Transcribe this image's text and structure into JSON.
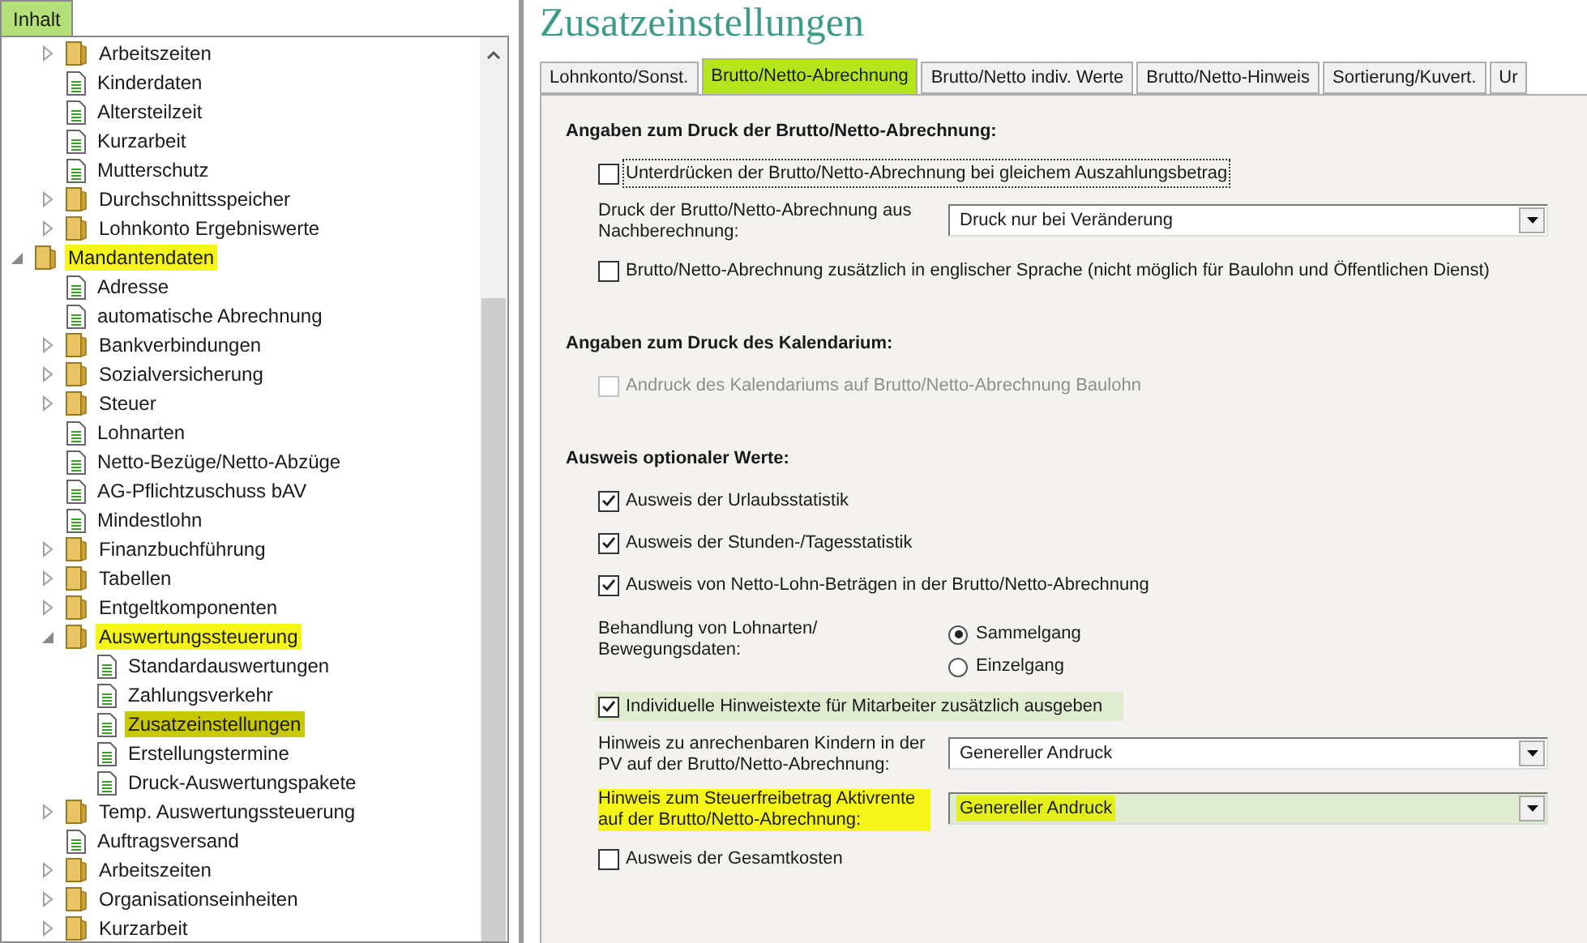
{
  "sidebar": {
    "tab": {
      "label": "Inhalt",
      "selected": true
    },
    "tree": {
      "continued_items": [
        {
          "label": "Arbeitszeiten",
          "kind": "folder",
          "expanded": false,
          "selected": false,
          "highlighted": false
        },
        {
          "label": "Kinderdaten",
          "kind": "page",
          "selected": false,
          "highlighted": false
        },
        {
          "label": "Altersteilzeit",
          "kind": "page",
          "selected": false,
          "highlighted": false
        },
        {
          "label": "Kurzarbeit",
          "kind": "page",
          "selected": false,
          "highlighted": false
        },
        {
          "label": "Mutterschutz",
          "kind": "page",
          "selected": false,
          "highlighted": false
        },
        {
          "label": "Durchschnittsspeicher",
          "kind": "folder",
          "expanded": false,
          "selected": false,
          "highlighted": false
        },
        {
          "label": "Lohnkonto Ergebniswerte",
          "kind": "folder",
          "expanded": false,
          "selected": false,
          "highlighted": false
        }
      ],
      "items": [
        {
          "label": "Mandantendaten",
          "kind": "folder",
          "expanded": true,
          "selected": false,
          "highlighted": true,
          "children": [
            {
              "label": "Adresse",
              "kind": "page",
              "selected": false,
              "highlighted": false
            },
            {
              "label": "automatische Abrechnung",
              "kind": "page",
              "selected": false,
              "highlighted": false
            },
            {
              "label": "Bankverbindungen",
              "kind": "folder",
              "expanded": false,
              "selected": false,
              "highlighted": false
            },
            {
              "label": "Sozialversicherung",
              "kind": "folder",
              "expanded": false,
              "selected": false,
              "highlighted": false
            },
            {
              "label": "Steuer",
              "kind": "folder",
              "expanded": false,
              "selected": false,
              "highlighted": false
            },
            {
              "label": "Lohnarten",
              "kind": "page",
              "selected": false,
              "highlighted": false
            },
            {
              "label": "Netto-Bezüge/Netto-Abzüge",
              "kind": "page",
              "selected": false,
              "highlighted": false
            },
            {
              "label": "AG-Pflichtzuschuss bAV",
              "kind": "page",
              "selected": false,
              "highlighted": false
            },
            {
              "label": "Mindestlohn",
              "kind": "page",
              "selected": false,
              "highlighted": false
            },
            {
              "label": "Finanzbuchführung",
              "kind": "folder",
              "expanded": false,
              "selected": false,
              "highlighted": false
            },
            {
              "label": "Tabellen",
              "kind": "folder",
              "expanded": false,
              "selected": false,
              "highlighted": false
            },
            {
              "label": "Entgeltkomponenten",
              "kind": "folder",
              "expanded": false,
              "selected": false,
              "highlighted": false
            },
            {
              "label": "Auswertungssteuerung",
              "kind": "folder",
              "expanded": true,
              "selected": false,
              "highlighted": true,
              "children": [
                {
                  "label": "Standardauswertungen",
                  "kind": "page",
                  "selected": false,
                  "highlighted": false
                },
                {
                  "label": "Zahlungsverkehr",
                  "kind": "page",
                  "selected": false,
                  "highlighted": false
                },
                {
                  "label": "Zusatzeinstellungen",
                  "kind": "page",
                  "selected": true,
                  "highlighted": true
                },
                {
                  "label": "Erstellungstermine",
                  "kind": "page",
                  "selected": false,
                  "highlighted": false
                },
                {
                  "label": "Druck-Auswertungspakete",
                  "kind": "page",
                  "selected": false,
                  "highlighted": false
                }
              ]
            },
            {
              "label": "Temp. Auswertungssteuerung",
              "kind": "folder",
              "expanded": false,
              "selected": false,
              "highlighted": false
            },
            {
              "label": "Auftragsversand",
              "kind": "page",
              "selected": false,
              "highlighted": false
            },
            {
              "label": "Arbeitszeiten",
              "kind": "folder",
              "expanded": false,
              "selected": false,
              "highlighted": false
            },
            {
              "label": "Organisationseinheiten",
              "kind": "folder",
              "expanded": false,
              "selected": false,
              "highlighted": false
            },
            {
              "label": "Kurzarbeit",
              "kind": "folder",
              "expanded": false,
              "selected": false,
              "highlighted": false
            }
          ]
        }
      ]
    }
  },
  "main": {
    "title": "Zusatzeinstellungen",
    "tabs": [
      {
        "label": "Lohnkonto/Sonst.",
        "selected": false,
        "highlighted": false
      },
      {
        "label": "Brutto/Netto-Abrechnung",
        "selected": true,
        "highlighted": true
      },
      {
        "label": "Brutto/Netto indiv. Werte",
        "selected": false,
        "highlighted": false
      },
      {
        "label": "Brutto/Netto-Hinweis",
        "selected": false,
        "highlighted": false
      },
      {
        "label": "Sortierung/Kuvert.",
        "selected": false,
        "highlighted": false
      },
      {
        "label": "Ur",
        "selected": false,
        "highlighted": false
      }
    ],
    "sections": [
      {
        "title": "Angaben zum Druck der Brutto/Netto-Abrechnung:",
        "rows": [
          {
            "kind": "checkbox",
            "label": "Unterdrücken der Brutto/Netto-Abrechnung bei gleichem Auszahlungsbetrag",
            "checked": false,
            "disabled": false,
            "focused": true,
            "highlighted": false
          },
          {
            "kind": "dropdown",
            "label": "Druck der Brutto/Netto-Abrechnung aus Nachberechnung:",
            "value": "Druck nur bei Veränderung",
            "highlighted": false
          },
          {
            "kind": "checkbox",
            "label": "Brutto/Netto-Abrechnung zusätzlich in englischer Sprache (nicht möglich für Baulohn und Öffentlichen Dienst)",
            "checked": false,
            "disabled": false,
            "focused": false,
            "highlighted": false
          }
        ]
      },
      {
        "title": "Angaben zum Druck des Kalendarium:",
        "rows": [
          {
            "kind": "checkbox",
            "label": "Andruck des Kalendariums auf Brutto/Netto-Abrechnung Baulohn",
            "checked": false,
            "disabled": true,
            "focused": false,
            "highlighted": false
          }
        ]
      },
      {
        "title": "Ausweis optionaler Werte:",
        "rows": [
          {
            "kind": "checkbox",
            "label": "Ausweis der Urlaubsstatistik",
            "checked": true,
            "disabled": false,
            "focused": false,
            "highlighted": false
          },
          {
            "kind": "checkbox",
            "label": "Ausweis der Stunden-/Tagesstatistik",
            "checked": true,
            "disabled": false,
            "focused": false,
            "highlighted": false
          },
          {
            "kind": "checkbox",
            "label": "Ausweis von Netto-Lohn-Beträgen in der Brutto/Netto-Abrechnung",
            "checked": true,
            "disabled": false,
            "focused": false,
            "highlighted": false
          },
          {
            "kind": "radio_group",
            "label": "Behandlung von Lohnarten/ Bewegungsdaten:",
            "options": [
              {
                "label": "Sammelgang",
                "selected": true
              },
              {
                "label": "Einzelgang",
                "selected": false
              }
            ]
          },
          {
            "kind": "checkbox",
            "label": "Individuelle Hinweistexte für Mitarbeiter zusätzlich ausgeben",
            "checked": true,
            "disabled": false,
            "focused": false,
            "highlighted": true
          },
          {
            "kind": "dropdown",
            "label": "Hinweis zu anrechenbaren Kindern in der PV auf der Brutto/Netto-Abrechnung:",
            "value": "Genereller Andruck",
            "highlighted": false
          },
          {
            "kind": "dropdown",
            "label": "Hinweis zum Steuerfreibetrag Aktivrente auf der Brutto/Netto-Abrechnung:",
            "value": "Genereller Andruck",
            "highlighted": true
          },
          {
            "kind": "checkbox",
            "label": "Ausweis der Gesamtkosten",
            "checked": false,
            "disabled": false,
            "focused": false,
            "highlighted": false
          }
        ]
      }
    ]
  }
}
